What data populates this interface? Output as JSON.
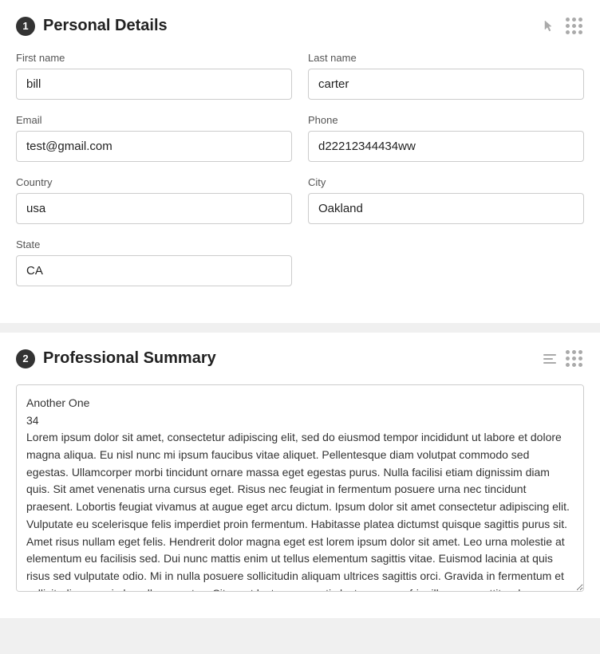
{
  "section1": {
    "number": "1",
    "title": "Personal Details",
    "fields": {
      "firstName": {
        "label": "First name",
        "value": "bill"
      },
      "lastName": {
        "label": "Last name",
        "value": "carter"
      },
      "email": {
        "label": "Email",
        "value": "test@gmail.com"
      },
      "phone": {
        "label": "Phone",
        "value": "d22212344434ww"
      },
      "country": {
        "label": "Country",
        "value": "usa"
      },
      "city": {
        "label": "City",
        "value": "Oakland"
      },
      "state": {
        "label": "State",
        "value": "CA"
      }
    }
  },
  "section2": {
    "number": "2",
    "title": "Professional Summary",
    "content": "Another One\n34\nLorem ipsum dolor sit amet, consectetur adipiscing elit, sed do eiusmod tempor incididunt ut labore et dolore magna aliqua. Eu nisl nunc mi ipsum faucibus vitae aliquet. Pellentesque diam volutpat commodo sed egestas. Ullamcorper morbi tincidunt ornare massa eget egestas purus. Nulla facilisi etiam dignissim diam quis. Sit amet venenatis urna cursus eget. Risus nec feugiat in fermentum posuere urna nec tincidunt praesent. Lobortis feugiat vivamus at augue eget arcu dictum. Ipsum dolor sit amet consectetur adipiscing elit. Vulputate eu scelerisque felis imperdiet proin fermentum. Habitasse platea dictumst quisque sagittis purus sit. Amet risus nullam eget felis. Hendrerit dolor magna eget est lorem ipsum dolor sit amet. Leo urna molestie at elementum eu facilisis sed. Dui nunc mattis enim ut tellus elementum sagittis vitae. Euismod lacinia at quis risus sed vulputate odio. Mi in nulla posuere sollicitudin aliquam ultrices sagittis orci. Gravida in fermentum et sollicitudin ac orci phasellus egestas. Sit amet luctus venenatis lectus magna fringilla urna porttitor rhoncus. Fermentum iaculis eu non diam."
  }
}
